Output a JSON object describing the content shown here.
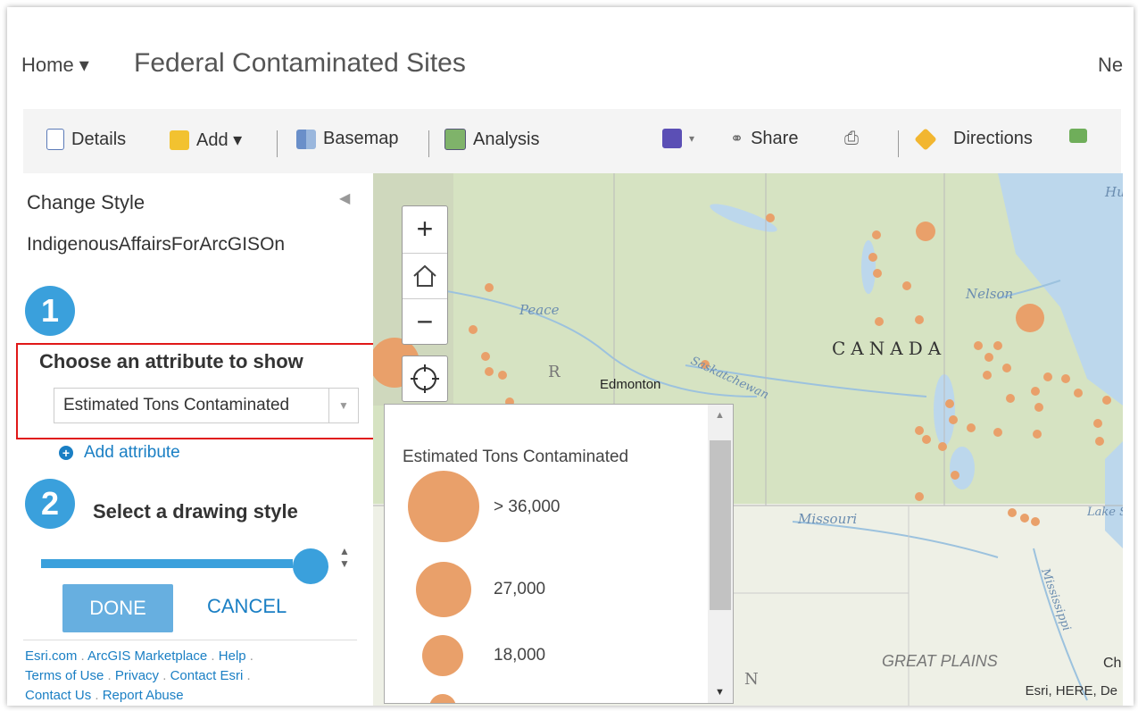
{
  "header": {
    "home_label": "Home ▾",
    "title": "Federal Contaminated Sites",
    "cut_label": "Ne"
  },
  "toolbar": {
    "details": "Details",
    "add": "Add ▾",
    "basemap": "Basemap",
    "analysis": "Analysis",
    "save": "▾",
    "share": "Share",
    "directions": "Directions"
  },
  "panel": {
    "title": "Change Style",
    "collapse": "◀",
    "layer_name": "IndigenousAffairsForArcGISOn",
    "step1": "1",
    "step2": "2",
    "choose_attr_label": "Choose an attribute to show",
    "attr_value": "Estimated Tons Contaminated",
    "add_attribute": "Add attribute",
    "draw_style_label": "Select a drawing style",
    "done": "DONE",
    "cancel": "CANCEL"
  },
  "footer": {
    "links": [
      "Esri.com",
      "ArcGIS Marketplace",
      "Help",
      "Terms of Use",
      "Privacy",
      "Contact Esri",
      "Contact Us",
      "Report Abuse"
    ],
    "separator": "."
  },
  "map": {
    "labels": {
      "canada": "CANADA",
      "edmonton": "Edmonton",
      "peace": "Peace",
      "nelson": "Nelson",
      "saskatchewan": "Saskatchewan",
      "missouri": "Missouri",
      "great_plains": "GREAT PLAINS",
      "mississippi": "Mississippi",
      "lake_superior": "Lake Superior",
      "hudson_bay": "Hu",
      "chicago": "Ch",
      "r_label": "R",
      "n_label": "N"
    },
    "attribution": "Esri, HERE, De",
    "dot_color": "#e9a06a"
  },
  "legend": {
    "title": "Estimated Tons Contaminated",
    "items": [
      {
        "label": "> 36,000"
      },
      {
        "label": "27,000"
      },
      {
        "label": "18,000"
      }
    ]
  }
}
